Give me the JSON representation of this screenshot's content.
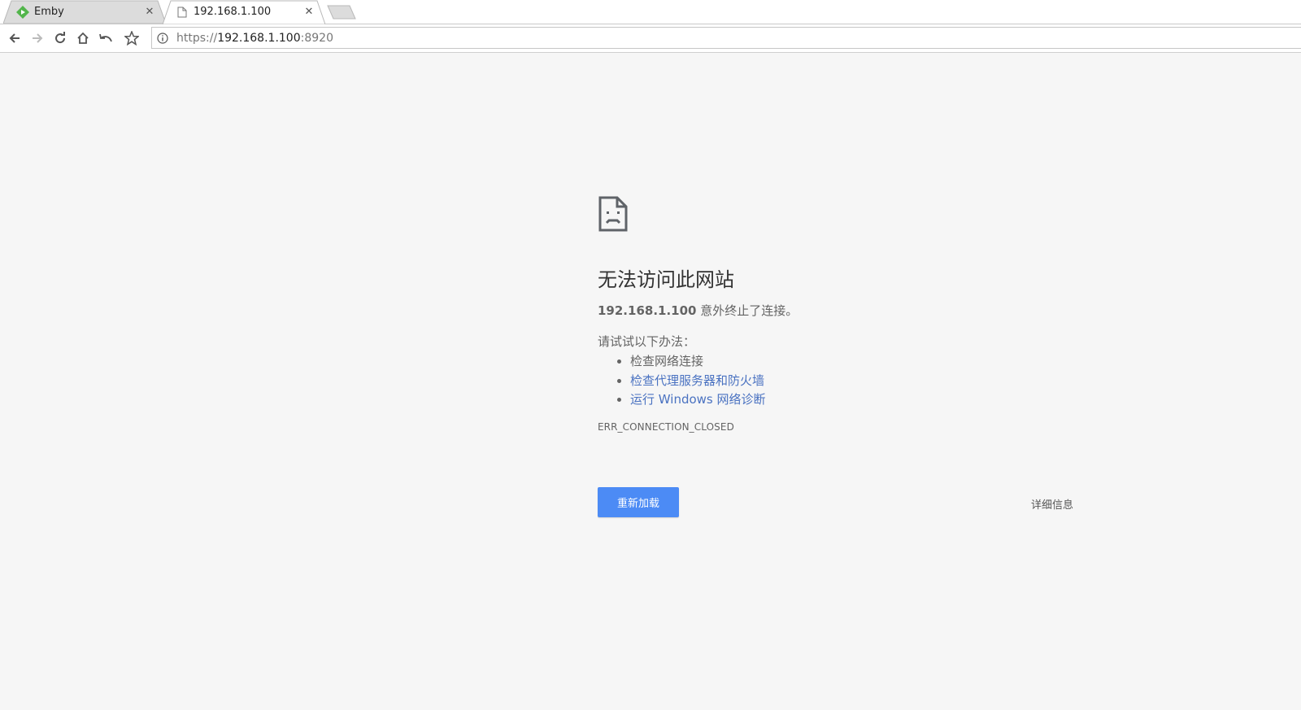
{
  "tabs": [
    {
      "title": "Emby",
      "favicon": "emby-icon",
      "active": false
    },
    {
      "title": "192.168.1.100",
      "favicon": "page-icon",
      "active": true
    }
  ],
  "toolbar": {
    "url_scheme": "https://",
    "url_host": "192.168.1.100",
    "url_port": ":8920"
  },
  "error": {
    "icon": "sad-page-icon",
    "title": "无法访问此网站",
    "host": "192.168.1.100",
    "message_suffix": " 意外终止了连接。",
    "suggestions_heading": "请试试以下办法：",
    "suggestions": [
      {
        "text": "检查网络连接",
        "link": false
      },
      {
        "text": "检查代理服务器和防火墙",
        "link": true
      },
      {
        "text": "运行 Windows 网络诊断",
        "link": true
      }
    ],
    "code": "ERR_CONNECTION_CLOSED",
    "reload_label": "重新加载",
    "details_label": "详细信息"
  },
  "colors": {
    "reload_button": "#4c8bf5",
    "link": "#4a72c1",
    "background": "#f6f6f6"
  }
}
